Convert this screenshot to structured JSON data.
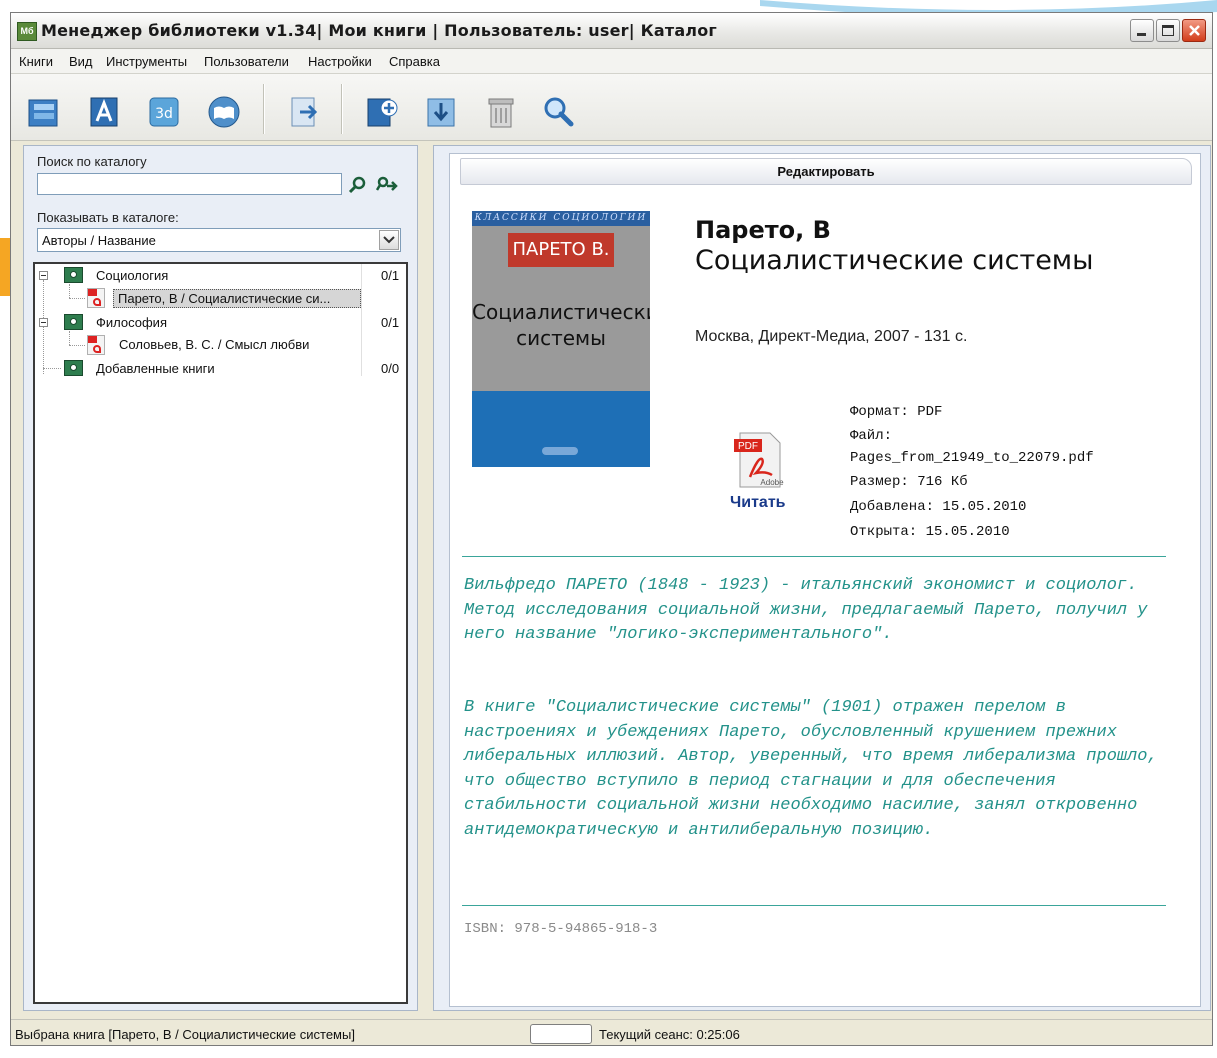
{
  "window": {
    "title": "Менеджер библиотеки v1.34| Мои книги | Пользователь: user| Каталог",
    "app_icon_text": "Мб"
  },
  "menu": [
    "Книги",
    "Вид",
    "Инструменты",
    "Пользователи",
    "Настройки",
    "Справка"
  ],
  "toolbar": {
    "icons": [
      "catalog-icon",
      "authors-icon",
      "3d-shelf-icon",
      "open-book-icon",
      "export-icon",
      "add-book-icon",
      "import-book-icon",
      "delete-book-icon",
      "search-icon"
    ]
  },
  "sidebar": {
    "search_label": "Поиск по каталогу",
    "search_value": "",
    "show_label": "Показывать в каталоге:",
    "show_selected": "Авторы / Название",
    "tree": [
      {
        "label": "Социология",
        "count": "0/1",
        "children": [
          "Парето, В / Социалистические си..."
        ]
      },
      {
        "label": "Философия",
        "count": "0/1",
        "children": [
          "Соловьев, В. С. / Смысл любви"
        ]
      },
      {
        "label": "Добавленные книги",
        "count": "0/0",
        "children": []
      }
    ]
  },
  "detail": {
    "edit_button": "Редактировать",
    "cover": {
      "series": "КЛАССИКИ СОЦИОЛОГИИ",
      "author": "ПАРЕТО В.",
      "title_line1": "Социалистические",
      "title_line2": "системы"
    },
    "author": "Парето, В",
    "title": "Социалистические системы",
    "publication": "Москва, Директ-Медиа, 2007 - 131 с.",
    "pdf_icon_text": "PDF",
    "pdf_brand": "Adobe",
    "read_link": "Читать",
    "meta": {
      "format": "Формат: PDF",
      "file_label": "Файл:",
      "file_name": "Pages_from_21949_to_22079.pdf",
      "size": "Размер: 716 Кб",
      "added": "Добавлена: 15.05.2010",
      "opened": "Открыта: 15.05.2010"
    },
    "description_1": "Вильфредо ПАРЕТО (1848 - 1923) - итальянский экономист и социолог. Метод исследования социальной жизни, предлагаемый Парето, получил у него название \"логико-экспериментального\".",
    "description_2": "В книге \"Социалистические системы\" (1901) отражен перелом в настроениях и убеждениях Парето, обусловленный крушением прежних либеральных иллюзий. Автор, уверенный, что время либерализма прошло, что общество вступило в период стагнации и для обеспечения стабильности социальной жизни необходимо насилие, занял откровенно антидемократическую и антилиберальную позицию.",
    "isbn": "ISBN: 978-5-94865-918-3"
  },
  "status": {
    "selected": "Выбрана книга [Парето, В / Социалистические системы]",
    "session": "Текущий сеанс: 0:25:06"
  },
  "colors": {
    "accent_orange": "#f5a623",
    "description_teal": "#23928a",
    "divider_teal": "#3aa59a",
    "link_blue": "#1a3a8a"
  }
}
